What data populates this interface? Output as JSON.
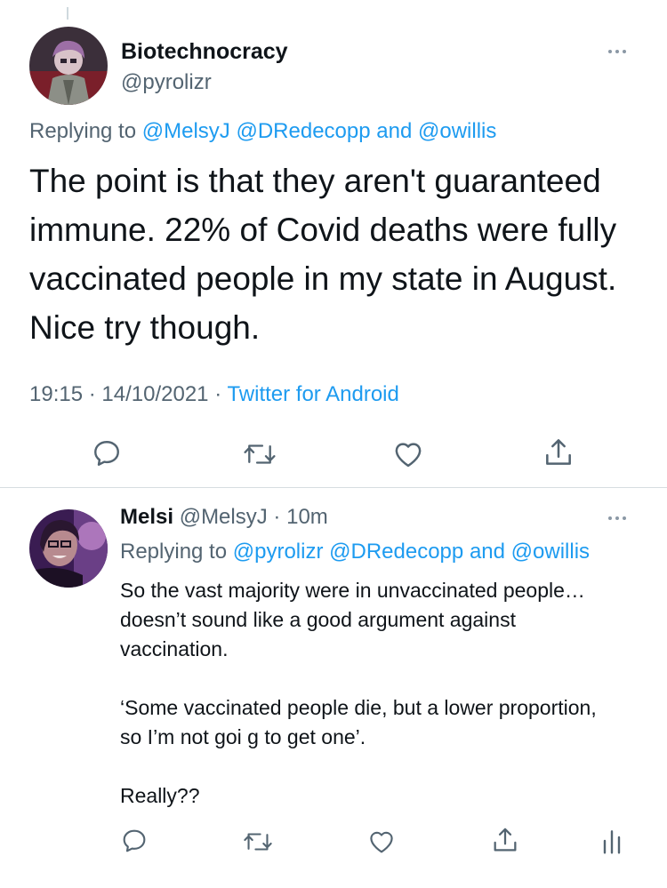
{
  "tweet": {
    "author_name": "Biotechnocracy",
    "author_handle": "@pyrolizr",
    "replying_prefix": "Replying to",
    "replying_mentions": [
      "@MelsyJ",
      "@DRedecopp"
    ],
    "replying_and": "and",
    "replying_last": "@owillis",
    "text": "The point is that they aren't guaranteed immune. 22% of Covid deaths were fully vaccinated people in my state in August. Nice try though.",
    "time": "19:15",
    "date": "14/10/2021",
    "separator": "·",
    "source": "Twitter for Android"
  },
  "reply": {
    "author_name": "Melsi",
    "author_handle": "@MelsyJ",
    "separator": "·",
    "time_ago": "10m",
    "replying_prefix": "Replying to",
    "replying_mentions": [
      "@pyrolizr",
      "@DRedecopp"
    ],
    "replying_and": "and",
    "replying_last": "@owillis",
    "paragraphs": [
      "So the vast majority were in unvaccinated people… doesn’t sound like a good argument against vaccination.",
      "‘Some vaccinated people die, but a lower proportion, so I’m not goi g to get one’.",
      "Really??"
    ]
  },
  "icons": {
    "reply": "reply-icon",
    "retweet": "retweet-icon",
    "like": "heart-icon",
    "share": "share-icon",
    "analytics": "analytics-icon",
    "more": "more-icon"
  },
  "colors": {
    "link": "#1d9bf0",
    "secondary_text": "#536471",
    "primary_text": "#0f1419",
    "icon": "#536471"
  }
}
